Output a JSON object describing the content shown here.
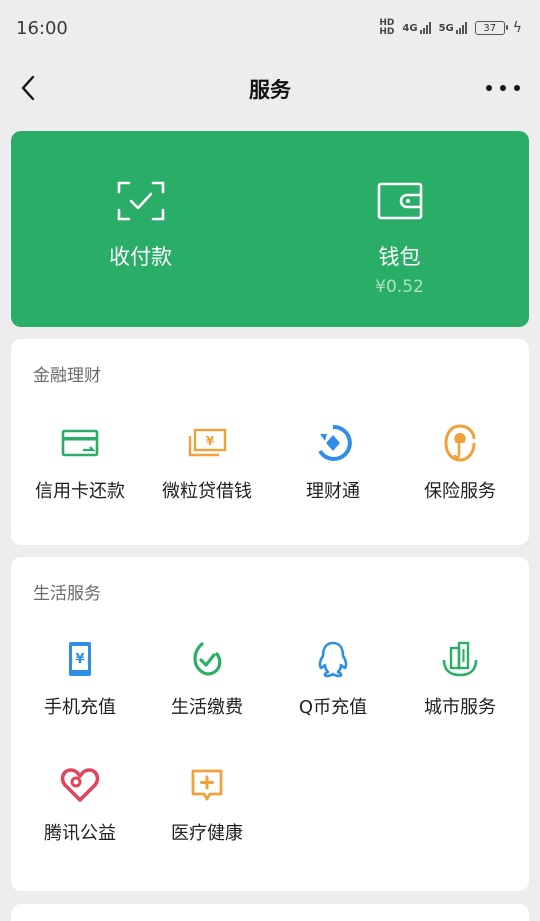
{
  "status_bar": {
    "time": "16:00",
    "hd_top": "HD",
    "hd_bottom": "HD",
    "net1": "4G",
    "net2": "5G",
    "battery": "37"
  },
  "nav": {
    "title": "服务"
  },
  "hero": {
    "pay": {
      "label": "收付款"
    },
    "wallet": {
      "label": "钱包",
      "balance": "¥0.52"
    }
  },
  "finance": {
    "title": "金融理财",
    "items": [
      {
        "label": "信用卡还款",
        "icon": "credit-card-icon",
        "color": "#2aae67"
      },
      {
        "label": "微粒贷借钱",
        "icon": "loan-icon",
        "color": "#f0a23a"
      },
      {
        "label": "理财通",
        "icon": "wealth-icon",
        "color": "#2f8fe8"
      },
      {
        "label": "保险服务",
        "icon": "insurance-icon",
        "color": "#f0a23a"
      }
    ]
  },
  "life": {
    "title": "生活服务",
    "items": [
      {
        "label": "手机充值",
        "icon": "phone-topup-icon",
        "color": "#2f8fe8"
      },
      {
        "label": "生活缴费",
        "icon": "utility-icon",
        "color": "#2aae67"
      },
      {
        "label": "Q币充值",
        "icon": "qq-icon",
        "color": "#2f8fe8"
      },
      {
        "label": "城市服务",
        "icon": "city-icon",
        "color": "#2aae67"
      },
      {
        "label": "腾讯公益",
        "icon": "charity-icon",
        "color": "#e2445c"
      },
      {
        "label": "医疗健康",
        "icon": "medical-icon",
        "color": "#f0a23a"
      }
    ]
  }
}
